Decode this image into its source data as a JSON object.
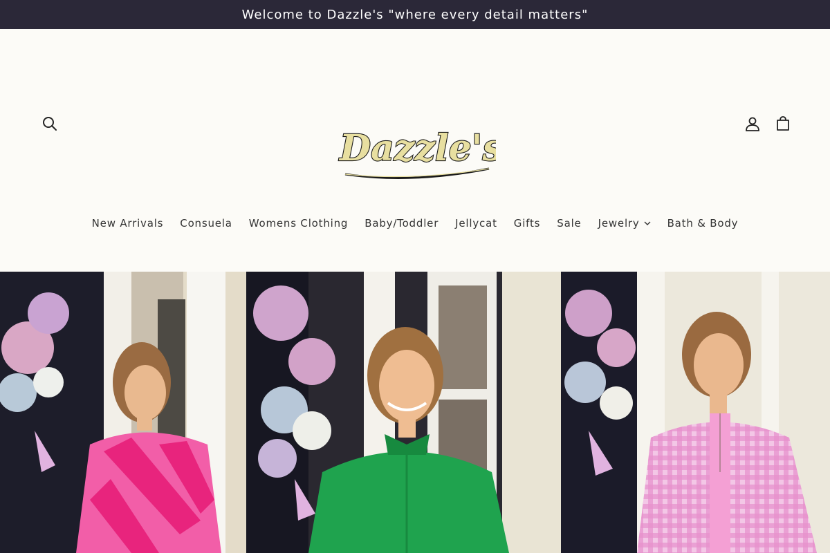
{
  "announcement": {
    "text": "Welcome to Dazzle's \"where every detail matters\""
  },
  "header": {
    "logo_text": "Dazzle's",
    "icons": {
      "search": "search-icon",
      "account": "account-icon",
      "cart": "cart-icon"
    }
  },
  "nav": {
    "items": [
      {
        "label": "New Arrivals"
      },
      {
        "label": "Consuela"
      },
      {
        "label": "Womens Clothing"
      },
      {
        "label": "Baby/Toddler"
      },
      {
        "label": "Jellycat"
      },
      {
        "label": "Gifts"
      },
      {
        "label": "Sale"
      },
      {
        "label": "Jewelry",
        "has_dropdown": true
      },
      {
        "label": "Bath & Body"
      }
    ]
  },
  "hero": {
    "panels": [
      {
        "name": "pink-striped-dress-photo",
        "dress_color": "#f0389a"
      },
      {
        "name": "green-blouse-photo",
        "dress_color": "#23a64f"
      },
      {
        "name": "pink-gingham-shirt-photo",
        "dress_color": "#ef8fd0"
      }
    ]
  },
  "colors": {
    "announcement_bg": "#2b2838",
    "header_bg": "#fcfbf7",
    "logo_gold": "#e8dfa0"
  }
}
